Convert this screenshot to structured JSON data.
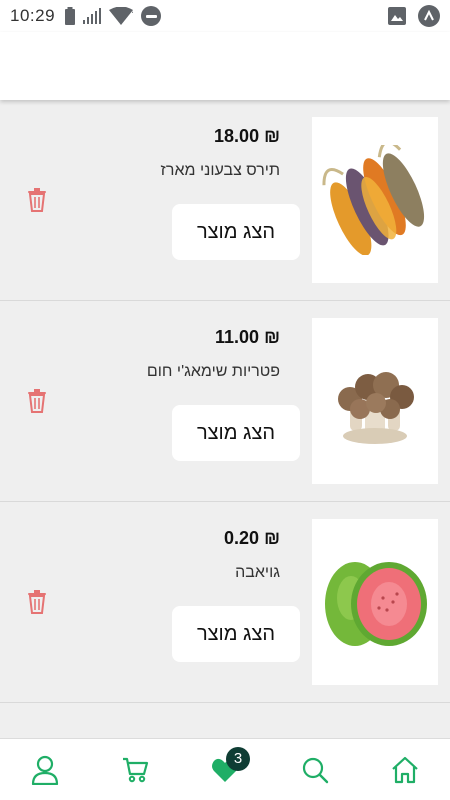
{
  "status_bar": {
    "time": "10:29",
    "icons": [
      "battery-icon",
      "signal-icon",
      "wifi-icon",
      "do-not-disturb-icon",
      "image-icon",
      "app-notification-icon"
    ]
  },
  "colors": {
    "accent": "#1fae66",
    "delete": "#e57373",
    "badge": "#0f3d34",
    "background": "#efefef"
  },
  "products": [
    {
      "price": "₪ 18.00",
      "name": "תירס צבעוני מארז",
      "button_label": "הצג מוצר",
      "image_icon": "colorful-corn-image"
    },
    {
      "price": "₪ 11.00",
      "name": "פטריות שימאג'י חום",
      "button_label": "הצג מוצר",
      "image_icon": "shimeji-mushrooms-image"
    },
    {
      "price": "₪ 0.20",
      "name": "גויאבה",
      "button_label": "הצג מוצר",
      "image_icon": "guava-image"
    }
  ],
  "bottom_nav": {
    "items": [
      "profile-icon",
      "cart-icon",
      "favorites-icon",
      "search-icon",
      "home-icon"
    ],
    "favorites_count": "3"
  }
}
